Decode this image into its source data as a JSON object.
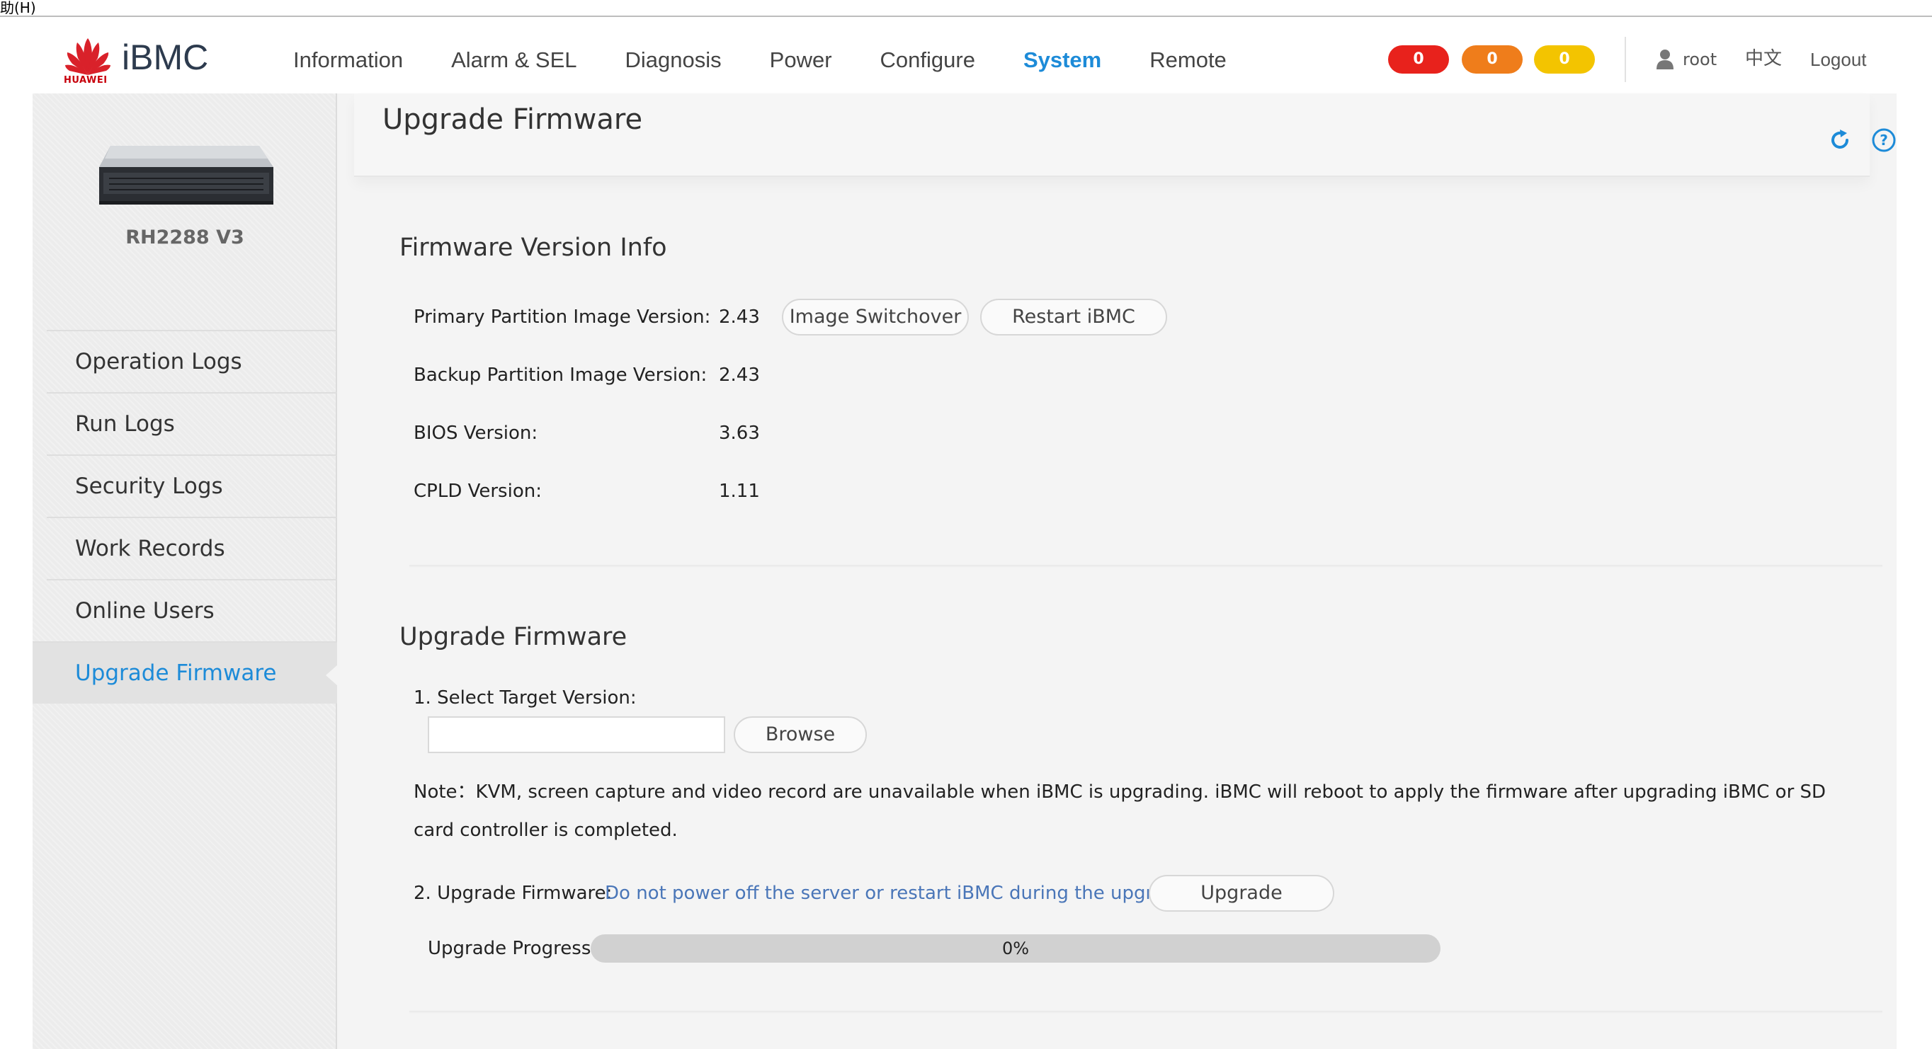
{
  "topbar": {
    "fragment": "助(H)"
  },
  "header": {
    "brand": "iBMC",
    "logo_word": "HUAWEI",
    "nav": [
      "Information",
      "Alarm & SEL",
      "Diagnosis",
      "Power",
      "Configure",
      "System",
      "Remote"
    ],
    "active_nav": "System",
    "alarms": {
      "critical": "0",
      "major": "0",
      "minor": "0"
    },
    "alarm_colors": {
      "critical": "#e8221c",
      "major": "#ef7d1b",
      "minor": "#f3c400"
    },
    "user": "root",
    "language": "中文",
    "logout": "Logout",
    "icons": [
      "huawei-logo-icon",
      "user-icon",
      "refresh-icon",
      "help-icon"
    ]
  },
  "sidebar": {
    "device_name": "RH2288 V3",
    "items": [
      "Operation Logs",
      "Run Logs",
      "Security Logs",
      "Work Records",
      "Online Users",
      "Upgrade Firmware"
    ],
    "active_item": "Upgrade Firmware"
  },
  "page": {
    "title": "Upgrade Firmware",
    "firmware_info": {
      "title": "Firmware Version Info",
      "rows": [
        {
          "label": "Primary Partition Image Version:",
          "value": "2.43"
        },
        {
          "label": "Backup Partition Image Version:",
          "value": "2.43"
        },
        {
          "label": "BIOS Version:",
          "value": "3.63"
        },
        {
          "label": "CPLD Version:",
          "value": "1.11"
        }
      ],
      "image_switchover_label": "Image Switchover",
      "restart_label": "Restart iBMC"
    },
    "upgrade": {
      "title": "Upgrade Firmware",
      "step1_label": "1. Select Target Version:",
      "file_value": "",
      "browse_label": "Browse",
      "note": "Note：KVM, screen capture and video record are unavailable when iBMC is upgrading. iBMC will reboot to apply the firmware after upgrading iBMC or SD card controller is completed.",
      "step2_label": "2. Upgrade Firmware:",
      "warning": "Do not power off the server or restart iBMC during the upgrade.",
      "upgrade_label": "Upgrade",
      "progress_label": "Upgrade Progress:",
      "progress_text": "0%",
      "progress_value": 0
    }
  }
}
